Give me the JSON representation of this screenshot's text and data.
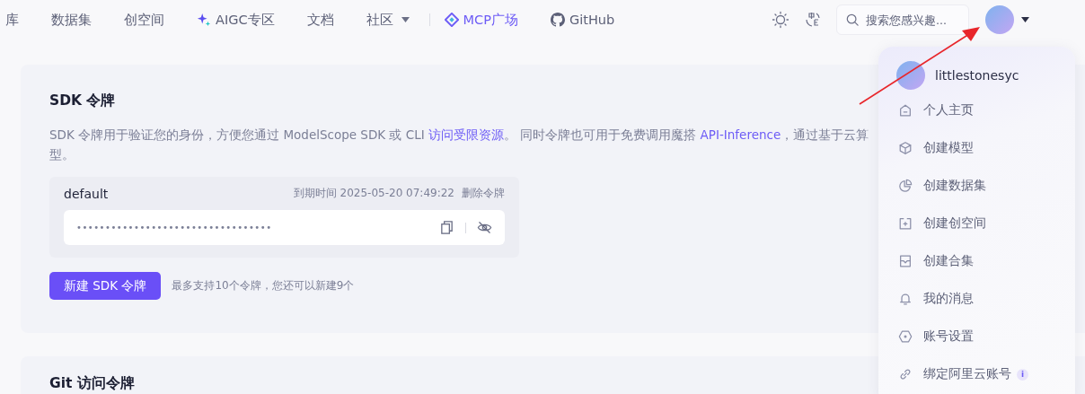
{
  "nav": {
    "items": [
      {
        "kind": "plain",
        "label": "库"
      },
      {
        "kind": "plain",
        "label": "数据集"
      },
      {
        "kind": "plain",
        "label": "创空间"
      },
      {
        "kind": "aigc",
        "label": "AIGC专区"
      },
      {
        "kind": "plain",
        "label": "文档"
      },
      {
        "kind": "dropdown",
        "label": "社区"
      },
      {
        "kind": "mcp",
        "label": "MCP广场"
      },
      {
        "kind": "github",
        "label": "GitHub"
      }
    ],
    "search": {
      "placeholder": "搜索您感兴趣..."
    }
  },
  "sdk_card": {
    "title": "SDK 令牌",
    "description_line1": [
      {
        "kind": "text",
        "text": "SDK 令牌用于验证您的身份，方便您通过 ModelScope SDK 或 CLI "
      },
      {
        "kind": "link",
        "text": "访问受限资源"
      },
      {
        "kind": "text",
        "text": "。 同时令牌也可用于免费调用魔搭 "
      },
      {
        "kind": "link",
        "text": "API-Inference"
      },
      {
        "kind": "text",
        "text": "，通过基于云算"
      }
    ],
    "description_line2": "型。",
    "token": {
      "name": "default",
      "expiry": "到期时间 2025-05-20 07:49:22",
      "delete": "删除令牌",
      "masked_value": "••••••••••••••••••••••••••••••••••"
    },
    "new_button": "新建 SDK 令牌",
    "limit_hint": "最多支持10个令牌，您还可以新建9个"
  },
  "git_card": {
    "title": "Git 访问令牌"
  },
  "user_menu": {
    "username": "littlestonesyc",
    "items": [
      {
        "kind": "home",
        "label": "个人主页"
      },
      {
        "kind": "cube",
        "label": "创建模型"
      },
      {
        "kind": "pie",
        "label": "创建数据集"
      },
      {
        "kind": "space",
        "label": "创建创空间"
      },
      {
        "kind": "collection",
        "label": "创建合集"
      },
      {
        "kind": "bell",
        "label": "我的消息"
      },
      {
        "kind": "settings",
        "label": "账号设置"
      },
      {
        "kind": "link",
        "label": "绑定阿里云账号",
        "badge": "i"
      }
    ]
  }
}
